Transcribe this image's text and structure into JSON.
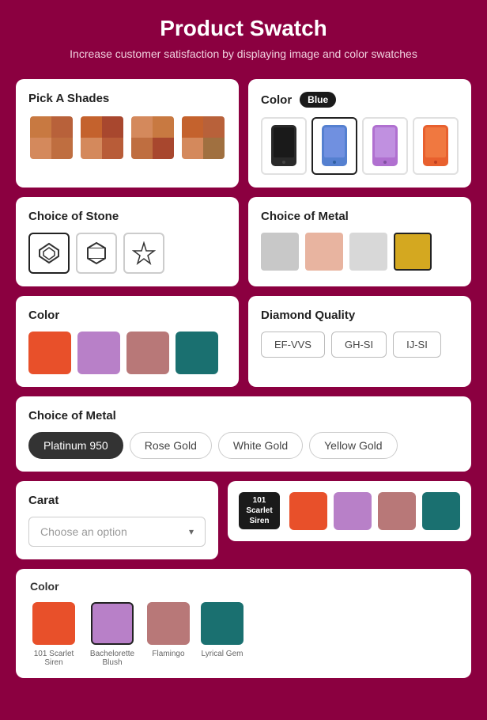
{
  "header": {
    "title": "Product Swatch",
    "subtitle": "Increase customer satisfaction by displaying image and color swatches"
  },
  "shadesCard": {
    "title": "Pick A Shades",
    "swatches": [
      {
        "id": "swatch-1",
        "cells": [
          "#c87941",
          "#b8613a",
          "#d4895c",
          "#bf6e40"
        ],
        "selected": false
      },
      {
        "id": "swatch-2",
        "cells": [
          "#c4622d",
          "#a8472e",
          "#d4895c",
          "#b85c38"
        ],
        "selected": false
      },
      {
        "id": "swatch-3",
        "cells": [
          "#d4895c",
          "#c87941",
          "#bf6e40",
          "#a8472e"
        ],
        "selected": false
      },
      {
        "id": "swatch-4",
        "cells": [
          "#c4622d",
          "#b8613a",
          "#d4895c",
          "#a07040"
        ],
        "selected": false
      }
    ]
  },
  "colorCard": {
    "title": "Color",
    "badge": "Blue",
    "phones": [
      {
        "id": "phone-black",
        "color": "#1a1a1a",
        "selected": false
      },
      {
        "id": "phone-blue",
        "color": "#4a7bc8",
        "selected": true
      },
      {
        "id": "phone-purple",
        "color": "#b07cc8",
        "selected": false
      },
      {
        "id": "phone-orange",
        "color": "#e8602e",
        "selected": false
      }
    ]
  },
  "stoneCard": {
    "title": "Choice of Stone",
    "stones": [
      {
        "id": "stone-1",
        "symbol": "◇",
        "selected": true
      },
      {
        "id": "stone-2",
        "symbol": "⬡",
        "selected": false
      },
      {
        "id": "stone-3",
        "symbol": "✦",
        "selected": false
      }
    ]
  },
  "metalColorCard": {
    "title": "Choice of Metal",
    "swatches": [
      {
        "id": "metal-silver",
        "color": "#c8c8c8",
        "selected": false
      },
      {
        "id": "metal-rose",
        "color": "#e8b4a0",
        "selected": false
      },
      {
        "id": "metal-light",
        "color": "#d8d8d8",
        "selected": false
      },
      {
        "id": "metal-gold",
        "color": "#d4a820",
        "selected": true
      }
    ]
  },
  "colorBlockCard": {
    "title": "Color",
    "swatches": [
      {
        "id": "color-orange",
        "color": "#e8502a",
        "selected": false
      },
      {
        "id": "color-purple",
        "color": "#b880c8",
        "selected": false
      },
      {
        "id": "color-mauve",
        "color": "#b87878",
        "selected": false
      },
      {
        "id": "color-teal",
        "color": "#1a7070",
        "selected": false
      }
    ]
  },
  "diamondCard": {
    "title": "Diamond Quality",
    "options": [
      {
        "id": "ef-vvs",
        "label": "EF-VVS"
      },
      {
        "id": "gh-si",
        "label": "GH-SI"
      },
      {
        "id": "ij-si",
        "label": "IJ-SI"
      }
    ]
  },
  "metalTextCard": {
    "title": "Choice of Metal",
    "options": [
      {
        "id": "platinum",
        "label": "Platinum 950",
        "selected": true
      },
      {
        "id": "rose-gold",
        "label": "Rose Gold",
        "selected": false
      },
      {
        "id": "white-gold",
        "label": "White Gold",
        "selected": false
      },
      {
        "id": "yellow-gold",
        "label": "Yellow Gold",
        "selected": false
      }
    ]
  },
  "caratCard": {
    "title": "Carat",
    "dropdown": {
      "placeholder": "Choose an option",
      "chevron": "▾"
    }
  },
  "sirenCard": {
    "badge": "101\nScarlet\nSiren",
    "swatches": [
      {
        "id": "siren-orange",
        "color": "#e8502a"
      },
      {
        "id": "siren-purple",
        "color": "#b880c8"
      },
      {
        "id": "siren-mauve",
        "color": "#b87878"
      },
      {
        "id": "siren-teal",
        "color": "#1a7070"
      }
    ]
  },
  "bottomColorCard": {
    "title": "Color",
    "options": [
      {
        "id": "bc-scarlet",
        "label": "101 Scarlet Siren",
        "color": "#e8502a",
        "selected": false
      },
      {
        "id": "bc-blush",
        "label": "Bachelorette Blush",
        "color": "#b880c8",
        "selected": true
      },
      {
        "id": "bc-flamingo",
        "label": "Flamingo",
        "color": "#b87878",
        "selected": false
      },
      {
        "id": "bc-gem",
        "label": "Lyrical Gem",
        "color": "#1a7070",
        "selected": false
      }
    ]
  }
}
